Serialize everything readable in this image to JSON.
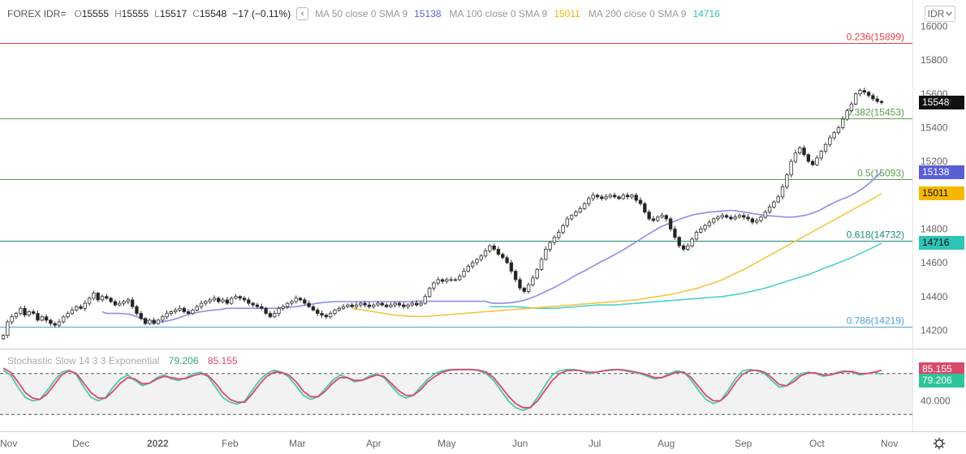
{
  "legend": {
    "symbol": "FOREX IDR=",
    "o_key": "O",
    "o_val": "15555",
    "h_key": "H",
    "h_val": "15555",
    "l_key": "L",
    "l_val": "15517",
    "c_key": "C",
    "c_val": "15548",
    "change": "−17 (−0.11%)",
    "collapse": "‹",
    "ma50_label": "MA 50 close 0 SMA 9",
    "ma50_value": "15138",
    "ma100_label": "MA 100 close 0 SMA 9",
    "ma100_value": "15011",
    "ma200_label": "MA 200 close 0 SMA 9",
    "ma200_value": "14716"
  },
  "symbol_button": {
    "label": "IDR",
    "icon": "chevron-down-icon"
  },
  "stoch_legend": {
    "title": "Stochastic Slow 14 3 3 Exponential",
    "k": "79.206",
    "d": "85.155"
  },
  "colors": {
    "up": "#ffffff",
    "down": "#222222",
    "wick": "#333333",
    "ma50": "#8b8ee8",
    "ma100": "#f5c542",
    "ma200": "#4dd0c8",
    "fib_red": "#e0424b",
    "fib_green": "#5b9e4d",
    "fib_teal": "#1f8a7a",
    "fib_blue": "#4da3d6",
    "stoch_k": "#4ec9a3",
    "stoch_d": "#d84a6b",
    "stoch_bg": "#f2f2f2"
  },
  "price_labels": {
    "last": {
      "text": "15548",
      "bg": "#111111",
      "fg": "#ffffff",
      "value": 15548
    },
    "ma50": {
      "text": "15138",
      "bg": "#5b5fd6",
      "fg": "#ffffff",
      "value": 15138
    },
    "ma100": {
      "text": "15011",
      "bg": "#f5b800",
      "fg": "#111111",
      "value": 15011
    },
    "ma200": {
      "text": "14716",
      "bg": "#2ec4b6",
      "fg": "#111111",
      "value": 14716
    },
    "stoch_d": {
      "text": "85.155",
      "bg": "#d84a6b",
      "fg": "#ffffff",
      "value": 85.155
    },
    "stoch_k": {
      "text": "79.206",
      "bg": "#2ec49a",
      "fg": "#ffffff",
      "value": 79.206
    }
  },
  "chart_data": {
    "type": "candlestick",
    "x_ticks": [
      "Nov",
      "Dec",
      "2022",
      "Feb",
      "Mar",
      "Apr",
      "May",
      "Jun",
      "Jul",
      "Aug",
      "Sep",
      "Oct",
      "Nov"
    ],
    "y_ticks": [
      16000,
      15800,
      15600,
      15400,
      15200,
      14800,
      14600,
      14400,
      14200
    ],
    "ylim": [
      14130,
      16050
    ],
    "fib_levels": [
      {
        "label": "0.236(15899)",
        "value": 15899,
        "color": "#e0424b"
      },
      {
        "label": "0.382(15453)",
        "value": 15453,
        "color": "#5b9e4d"
      },
      {
        "label": "0.5(15093)",
        "value": 15093,
        "color": "#5b9e4d"
      },
      {
        "label": "0.618(14732)",
        "value": 14732,
        "color": "#1f8a7a"
      },
      {
        "label": "0.786(14219)",
        "value": 14219,
        "color": "#4da3d6"
      }
    ],
    "close": [
      14170,
      14250,
      14280,
      14300,
      14330,
      14290,
      14310,
      14300,
      14260,
      14280,
      14260,
      14240,
      14230,
      14250,
      14280,
      14300,
      14320,
      14340,
      14330,
      14360,
      14390,
      14420,
      14380,
      14400,
      14390,
      14370,
      14350,
      14360,
      14370,
      14380,
      14340,
      14300,
      14270,
      14240,
      14260,
      14240,
      14260,
      14280,
      14300,
      14310,
      14320,
      14330,
      14310,
      14300,
      14320,
      14340,
      14360,
      14370,
      14380,
      14390,
      14370,
      14380,
      14360,
      14390,
      14400,
      14390,
      14380,
      14360,
      14350,
      14340,
      14330,
      14300,
      14280,
      14300,
      14330,
      14340,
      14360,
      14370,
      14390,
      14380,
      14360,
      14340,
      14320,
      14300,
      14290,
      14280,
      14300,
      14320,
      14330,
      14340,
      14350,
      14340,
      14350,
      14360,
      14350,
      14340,
      14350,
      14360,
      14350,
      14340,
      14350,
      14360,
      14350,
      14340,
      14350,
      14360,
      14350,
      14360,
      14400,
      14450,
      14480,
      14500,
      14490,
      14500,
      14500,
      14500,
      14520,
      14550,
      14580,
      14600,
      14620,
      14640,
      14670,
      14700,
      14680,
      14650,
      14630,
      14600,
      14550,
      14500,
      14450,
      14430,
      14470,
      14510,
      14560,
      14620,
      14680,
      14720,
      14750,
      14780,
      14820,
      14860,
      14880,
      14900,
      14920,
      14950,
      14980,
      15000,
      14990,
      14980,
      14990,
      15000,
      14990,
      14980,
      15000,
      14990,
      15000,
      14970,
      14950,
      14900,
      14860,
      14850,
      14870,
      14880,
      14860,
      14800,
      14750,
      14700,
      14680,
      14700,
      14740,
      14780,
      14800,
      14820,
      14840,
      14860,
      14870,
      14880,
      14870,
      14860,
      14870,
      14880,
      14870,
      14860,
      14840,
      14850,
      14870,
      14900,
      14930,
      14960,
      14990,
      15050,
      15120,
      15200,
      15250,
      15280,
      15240,
      15200,
      15180,
      15220,
      15260,
      15300,
      15340,
      15370,
      15400,
      15450,
      15500,
      15540,
      15600,
      15620,
      15610,
      15590,
      15570,
      15555,
      15548
    ],
    "ma50": [
      14310,
      14300,
      14300,
      14300,
      14300,
      14298,
      14296,
      14290,
      14280,
      14270,
      14262,
      14256,
      14250,
      14250,
      14250,
      14256,
      14260,
      14268,
      14276,
      14286,
      14294,
      14300,
      14306,
      14310,
      14314,
      14318,
      14320,
      14322,
      14326,
      14330,
      14330,
      14330,
      14330,
      14330,
      14330,
      14330,
      14330,
      14330,
      14330,
      14330,
      14330,
      14332,
      14334,
      14336,
      14338,
      14340,
      14344,
      14348,
      14352,
      14356,
      14360,
      14364,
      14366,
      14368,
      14370,
      14370,
      14370,
      14370,
      14370,
      14370,
      14370,
      14370,
      14370,
      14370,
      14370,
      14370,
      14370,
      14370,
      14370,
      14370,
      14370,
      14370,
      14370,
      14372,
      14372,
      14372,
      14372,
      14372,
      14372,
      14372,
      14372,
      14372,
      14372,
      14372,
      14372,
      14372,
      14372,
      14372,
      14372,
      14372,
      14364,
      14360,
      14360,
      14360,
      14362,
      14364,
      14368,
      14372,
      14378,
      14386,
      14396,
      14406,
      14418,
      14430,
      14442,
      14454,
      14468,
      14482,
      14496,
      14512,
      14526,
      14540,
      14552,
      14566,
      14580,
      14594,
      14608,
      14620,
      14634,
      14648,
      14662,
      14676,
      14692,
      14708,
      14724,
      14740,
      14756,
      14772,
      14788,
      14802,
      14816,
      14826,
      14836,
      14846,
      14856,
      14866,
      14874,
      14882,
      14888,
      14892,
      14896,
      14900,
      14902,
      14904,
      14906,
      14908,
      14910,
      14908,
      14904,
      14900,
      14896,
      14892,
      14888,
      14884,
      14880,
      14878,
      14876,
      14874,
      14872,
      14870,
      14870,
      14872,
      14876,
      14880,
      14886,
      14894,
      14904,
      14916,
      14930,
      14944,
      14956,
      14968,
      14978,
      14988,
      15000,
      15014,
      15030,
      15048,
      15068,
      15090,
      15114,
      15138
    ],
    "ma100": [
      14330,
      14326,
      14322,
      14318,
      14314,
      14310,
      14306,
      14302,
      14298,
      14294,
      14290,
      14288,
      14286,
      14284,
      14282,
      14282,
      14282,
      14282,
      14284,
      14286,
      14288,
      14290,
      14292,
      14294,
      14296,
      14298,
      14300,
      14302,
      14304,
      14306,
      14308,
      14310,
      14312,
      14314,
      14316,
      14318,
      14320,
      14322,
      14324,
      14326,
      14328,
      14330,
      14332,
      14334,
      14336,
      14338,
      14340,
      14342,
      14344,
      14346,
      14348,
      14350,
      14352,
      14354,
      14356,
      14358,
      14360,
      14362,
      14364,
      14366,
      14368,
      14370,
      14372,
      14374,
      14376,
      14378,
      14380,
      14384,
      14388,
      14392,
      14396,
      14400,
      14404,
      14408,
      14412,
      14418,
      14424,
      14430,
      14436,
      14442,
      14448,
      14456,
      14464,
      14472,
      14480,
      14490,
      14500,
      14512,
      14524,
      14536,
      14548,
      14560,
      14574,
      14588,
      14602,
      14616,
      14630,
      14644,
      14658,
      14672,
      14686,
      14700,
      14714,
      14728,
      14742,
      14756,
      14770,
      14784,
      14798,
      14812,
      14826,
      14840,
      14854,
      14868,
      14882,
      14896,
      14910,
      14924,
      14938,
      14952,
      14966,
      14980,
      14994,
      15011
    ],
    "ma200": [
      14340,
      14340,
      14340,
      14340,
      14340,
      14340,
      14340,
      14338,
      14336,
      14334,
      14332,
      14330,
      14330,
      14330,
      14330,
      14330,
      14332,
      14334,
      14336,
      14338,
      14340,
      14342,
      14344,
      14346,
      14348,
      14350,
      14350,
      14350,
      14350,
      14350,
      14352,
      14354,
      14356,
      14358,
      14360,
      14362,
      14364,
      14366,
      14368,
      14370,
      14372,
      14374,
      14376,
      14378,
      14380,
      14382,
      14384,
      14386,
      14388,
      14390,
      14392,
      14394,
      14396,
      14398,
      14400,
      14404,
      14408,
      14412,
      14416,
      14420,
      14426,
      14432,
      14438,
      14444,
      14450,
      14458,
      14466,
      14474,
      14482,
      14490,
      14498,
      14506,
      14514,
      14522,
      14530,
      14540,
      14550,
      14560,
      14570,
      14580,
      14590,
      14600,
      14610,
      14620,
      14630,
      14642,
      14654,
      14666,
      14678,
      14690,
      14702,
      14716
    ],
    "stoch_k": [
      85,
      78,
      60,
      45,
      40,
      42,
      55,
      70,
      82,
      85,
      78,
      60,
      45,
      40,
      45,
      60,
      72,
      78,
      70,
      62,
      66,
      74,
      78,
      72,
      70,
      74,
      80,
      82,
      75,
      60,
      45,
      38,
      35,
      40,
      55,
      70,
      80,
      85,
      82,
      75,
      62,
      48,
      42,
      46,
      58,
      70,
      78,
      74,
      68,
      70,
      76,
      80,
      74,
      62,
      50,
      44,
      48,
      60,
      72,
      80,
      84,
      86,
      86,
      86,
      86,
      84,
      80,
      70,
      55,
      40,
      30,
      26,
      30,
      45,
      62,
      78,
      84,
      86,
      86,
      84,
      80,
      82,
      84,
      86,
      86,
      84,
      82,
      80,
      76,
      72,
      74,
      80,
      84,
      82,
      70,
      55,
      42,
      36,
      40,
      55,
      72,
      84,
      86,
      84,
      80,
      70,
      60,
      62,
      72,
      80,
      82,
      80,
      76,
      78,
      82,
      84,
      82,
      78,
      80,
      82,
      79
    ],
    "stoch_d": [
      88,
      82,
      68,
      52,
      44,
      42,
      50,
      64,
      78,
      84,
      80,
      66,
      52,
      44,
      44,
      54,
      66,
      74,
      72,
      65,
      66,
      72,
      76,
      74,
      72,
      73,
      77,
      80,
      77,
      66,
      52,
      42,
      38,
      38,
      50,
      64,
      76,
      82,
      82,
      78,
      68,
      54,
      46,
      46,
      54,
      66,
      74,
      74,
      70,
      70,
      74,
      78,
      76,
      66,
      55,
      48,
      48,
      56,
      68,
      76,
      82,
      85,
      86,
      86,
      86,
      85,
      82,
      74,
      61,
      47,
      36,
      30,
      30,
      40,
      55,
      70,
      80,
      84,
      85,
      84,
      82,
      82,
      84,
      85,
      86,
      85,
      83,
      81,
      78,
      74,
      74,
      78,
      82,
      82,
      74,
      61,
      48,
      40,
      40,
      50,
      66,
      79,
      84,
      85,
      82,
      74,
      64,
      62,
      68,
      77,
      81,
      81,
      78,
      78,
      81,
      83,
      83,
      80,
      80,
      82,
      85
    ]
  },
  "x_axis": [
    "Nov",
    "Dec",
    "2022",
    "Feb",
    "Mar",
    "Apr",
    "May",
    "Jun",
    "Jul",
    "Aug",
    "Sep",
    "Oct",
    "Nov"
  ],
  "stoch_axis": {
    "ticks": [
      "40.000"
    ]
  },
  "settings_icon": "gear-icon"
}
